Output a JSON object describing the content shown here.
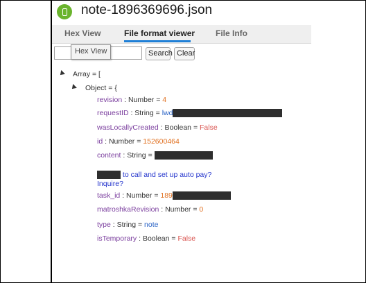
{
  "window": {
    "title": "note-1896369696.json"
  },
  "tabs": [
    {
      "label": "Hex View",
      "active": false
    },
    {
      "label": "File format viewer",
      "active": true
    },
    {
      "label": "File Info",
      "active": false
    }
  ],
  "toolbar": {
    "search_value": "",
    "search_label": "Search",
    "clear_label": "Clear",
    "tooltip": "Hex View"
  },
  "tree": {
    "root_label": "Array = [",
    "object_label": "Object = {",
    "fields": {
      "revision": {
        "key": "revision",
        "type": "Number",
        "value": "4"
      },
      "requestID": {
        "key": "requestID",
        "type": "String",
        "value": "lwd"
      },
      "wasLocallyCreated": {
        "key": "wasLocallyCreated",
        "type": "Boolean",
        "value": "False"
      },
      "id": {
        "key": "id",
        "type": "Number",
        "value": "152600464"
      },
      "content": {
        "key": "content",
        "type": "String"
      },
      "content_line1": "to call and set up auto pay?",
      "content_line2": "Inquire?",
      "task_id": {
        "key": "task_id",
        "type": "Number",
        "value": "189"
      },
      "matroshkaRevision": {
        "key": "matroshkaRevision",
        "type": "Number",
        "value": "0"
      },
      "type": {
        "key": "type",
        "type": "String",
        "value": "note"
      },
      "isTemporary": {
        "key": "isTemporary",
        "type": "Boolean",
        "value": "False"
      }
    }
  },
  "colors": {
    "key": "#7b3f9e",
    "number": "#e07020",
    "boolean": "#d9534f",
    "string": "#2a63c5",
    "accent": "#1e7fd6",
    "app_icon": "#6ab42d"
  }
}
